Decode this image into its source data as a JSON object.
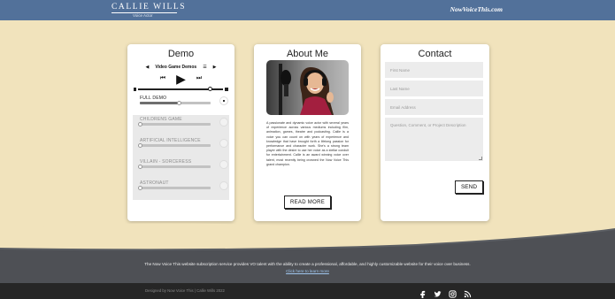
{
  "header": {
    "brand_name": "CALLIE WILLS",
    "brand_sub": "Voice Actor",
    "site_badge": "NowVoiceThis.com"
  },
  "demo": {
    "title": "Demo",
    "playlist_title": "Video Game Demos",
    "tracks": [
      {
        "name": "FULL DEMO",
        "progress": 0.55,
        "state": "active"
      },
      {
        "name": "CHILDRENS GAME",
        "progress": 0.0,
        "state": "dim"
      },
      {
        "name": "ARTIFICIAL INTELLIGENCE",
        "progress": 0.0,
        "state": "dim"
      },
      {
        "name": "VILLAIN - SORCERESS",
        "progress": 0.0,
        "state": "dim"
      },
      {
        "name": "ASTRONAUT",
        "progress": 0.0,
        "state": "dim"
      }
    ],
    "playhead_progress": 0.84
  },
  "about": {
    "title": "About Me",
    "body": "A passionate and dynamic voice actor with several years of experience across various mediums including film, animation, games, theatre and podcasting. Callie is a voice you can count on with years of experience and knowledge that have brought forth a lifelong passion for performance and character work. She's a strong team player with the desire to use her voice as a stellar conduit for entertainment. Callie is an award winning voice over talent, most recently being crowned the Now Voice This grand champion.",
    "button": "READ MORE"
  },
  "contact": {
    "title": "Contact",
    "first_name": "First Name",
    "last_name": "Last Name",
    "email": "Email Address",
    "message": "Question, Comment, or Project Description",
    "send": "SEND"
  },
  "footer": {
    "note": "The Now Voice This website subscription service provides VO talent with the ability to create a professional, affordable, and highly customizable website for their voice over business.",
    "link": "Click here to learn more",
    "credit": "Designed by Now Voice This | Callie Wills 2022"
  },
  "colors": {
    "header": "#52719a",
    "background": "#f1e3bc",
    "footer_band": "#4e5055",
    "footer_bar": "#262626"
  }
}
